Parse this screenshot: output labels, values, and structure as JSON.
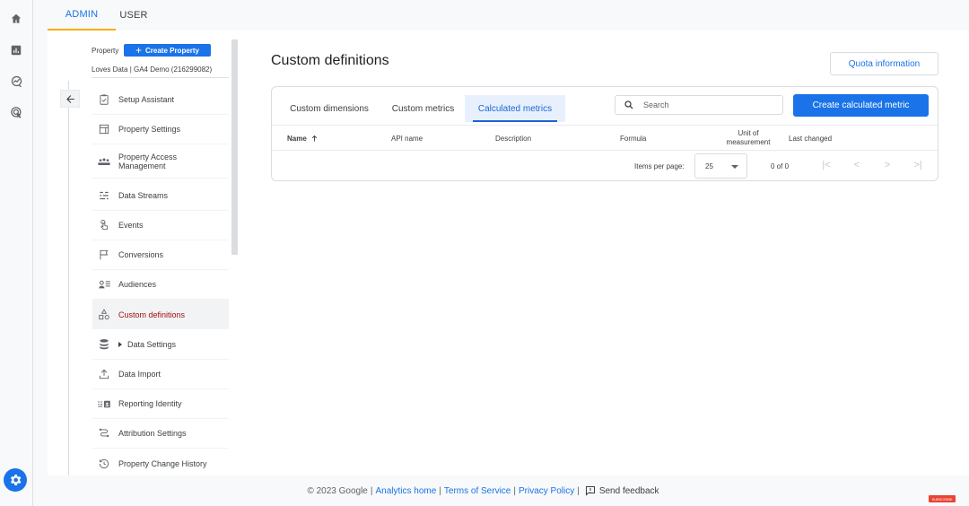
{
  "rail": {
    "items": [
      "home-icon",
      "reports-icon",
      "explore-icon",
      "advertising-icon"
    ],
    "settings": "admin-gear-icon"
  },
  "topbar": {
    "tabs": [
      {
        "label": "ADMIN",
        "active": true
      },
      {
        "label": "USER",
        "active": false
      }
    ]
  },
  "property": {
    "label": "Property",
    "create_button": "Create Property",
    "name": "Loves Data | GA4 Demo (216299082)"
  },
  "nav": {
    "items": [
      {
        "label": "Setup Assistant",
        "icon": "clipboard-check-icon"
      },
      {
        "label": "Property Settings",
        "icon": "property-settings-icon"
      },
      {
        "label": "Property Access Management",
        "icon": "people-icon"
      },
      {
        "label": "Data Streams",
        "icon": "data-streams-icon"
      },
      {
        "label": "Events",
        "icon": "touch-icon"
      },
      {
        "label": "Conversions",
        "icon": "flag-icon"
      },
      {
        "label": "Audiences",
        "icon": "audience-icon"
      },
      {
        "label": "Custom definitions",
        "icon": "shapes-icon",
        "active": true
      },
      {
        "label": "Data Settings",
        "icon": "database-icon",
        "expandable": true
      },
      {
        "label": "Data Import",
        "icon": "upload-icon"
      },
      {
        "label": "Reporting Identity",
        "icon": "identity-icon"
      },
      {
        "label": "Attribution Settings",
        "icon": "attribution-icon"
      },
      {
        "label": "Property Change History",
        "icon": "history-icon"
      }
    ]
  },
  "page": {
    "title": "Custom definitions",
    "quota_button": "Quota information"
  },
  "card": {
    "tabs": [
      {
        "label": "Custom dimensions",
        "active": false
      },
      {
        "label": "Custom metrics",
        "active": false
      },
      {
        "label": "Calculated metrics",
        "active": true
      }
    ],
    "search_placeholder": "Search",
    "create_button": "Create calculated metric",
    "columns": [
      "Name",
      "API name",
      "Description",
      "Formula",
      "Unit of measurement",
      "Last changed"
    ],
    "sort_column": "Name",
    "sort_direction": "ascending",
    "rows": [],
    "pager": {
      "items_per_page_label": "Items per page:",
      "items_per_page": "25",
      "range": "0 of 0"
    }
  },
  "footer": {
    "copyright": "© 2023 Google",
    "links": [
      "Analytics home",
      "Terms of Service",
      "Privacy Policy"
    ],
    "feedback": "Send feedback",
    "separator": "|"
  },
  "overlay": {
    "subscribe_badge": "SUBSCRIBE"
  }
}
